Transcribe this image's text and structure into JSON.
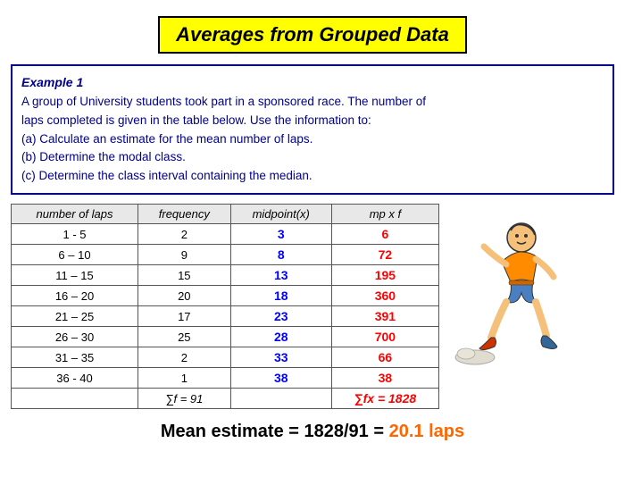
{
  "title": "Averages from Grouped Data",
  "example": {
    "label": "Example 1",
    "text1": "A group of University students took part in a sponsored race. The number of",
    "text2": "laps completed is given in the table below. Use the information to:",
    "text3": "(a) Calculate an estimate for the mean number of laps.",
    "text4": "(b) Determine the modal class.",
    "text5": "(c) Determine the class interval containing the median."
  },
  "table": {
    "headers": [
      "number of laps",
      "frequency",
      "midpoint(x)",
      "mp x f"
    ],
    "rows": [
      {
        "laps": "1 - 5",
        "freq": "2",
        "mid": "3",
        "mpf": "6"
      },
      {
        "laps": "6 – 10",
        "freq": "9",
        "mid": "8",
        "mpf": "72"
      },
      {
        "laps": "11 – 15",
        "freq": "15",
        "mid": "13",
        "mpf": "195"
      },
      {
        "laps": "16 – 20",
        "freq": "20",
        "mid": "18",
        "mpf": "360"
      },
      {
        "laps": "21 – 25",
        "freq": "17",
        "mid": "23",
        "mpf": "391"
      },
      {
        "laps": "26 – 30",
        "freq": "25",
        "mid": "28",
        "mpf": "700"
      },
      {
        "laps": "31 – 35",
        "freq": "2",
        "mid": "33",
        "mpf": "66"
      },
      {
        "laps": "36 - 40",
        "freq": "1",
        "mid": "38",
        "mpf": "38"
      }
    ],
    "sum_freq": "∑f = 91",
    "sum_mpf": "∑fx = 1828"
  },
  "mean_estimate": {
    "prefix": "Mean estimate = 1828/91 = ",
    "value": "20.1 laps"
  }
}
